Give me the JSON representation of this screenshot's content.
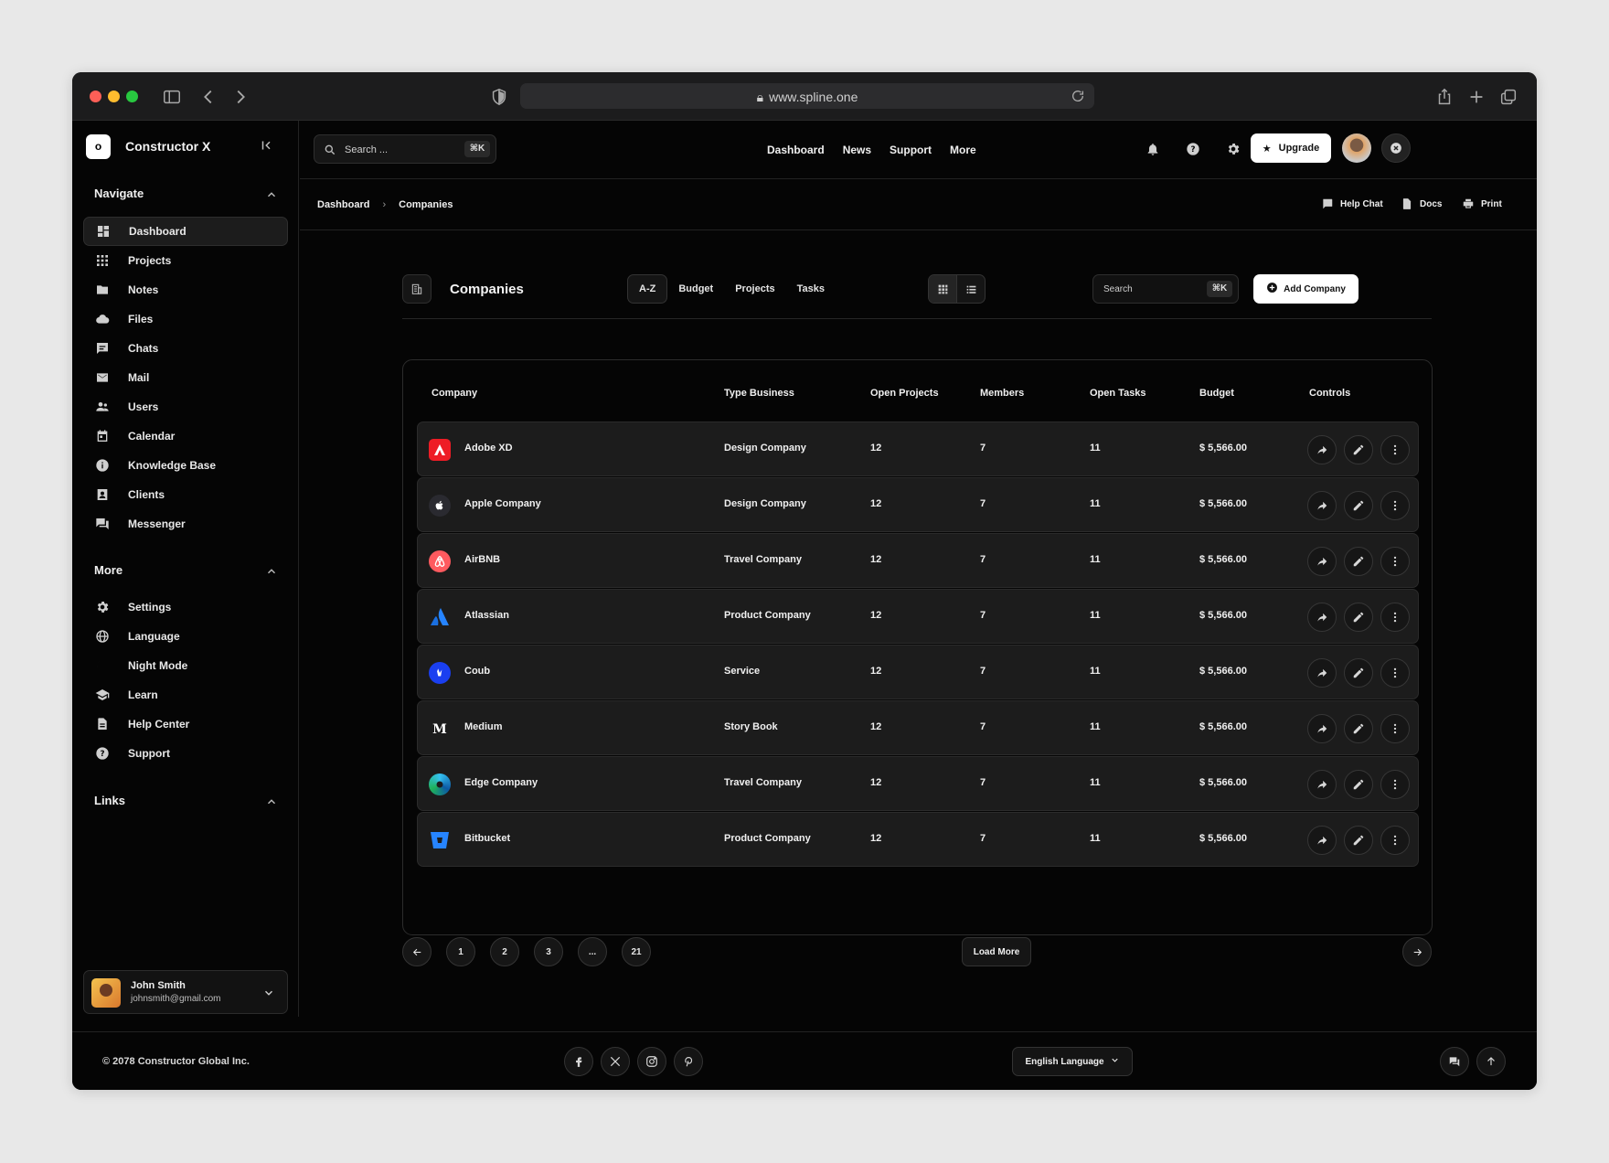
{
  "browser": {
    "url": "www.spline.one"
  },
  "sidebar": {
    "brand_logo": "o",
    "brand_name": "Constructor X",
    "navigate_title": "Navigate",
    "navigate": [
      {
        "label": "Dashboard",
        "icon": "dashboard-icon"
      },
      {
        "label": "Projects",
        "icon": "grid-icon"
      },
      {
        "label": "Notes",
        "icon": "folder-icon"
      },
      {
        "label": "Files",
        "icon": "cloud-icon"
      },
      {
        "label": "Chats",
        "icon": "chat-icon"
      },
      {
        "label": "Mail",
        "icon": "mail-icon"
      },
      {
        "label": "Users",
        "icon": "users-icon"
      },
      {
        "label": "Calendar",
        "icon": "calendar-icon"
      },
      {
        "label": "Knowledge Base",
        "icon": "info-icon"
      },
      {
        "label": "Clients",
        "icon": "contact-card-icon"
      },
      {
        "label": "Messenger",
        "icon": "forum-icon"
      }
    ],
    "more_title": "More",
    "more": [
      {
        "label": "Settings",
        "icon": "gear-icon"
      },
      {
        "label": "Language",
        "icon": "globe-icon"
      },
      {
        "label": "Night Mode",
        "icon": "moon-icon"
      },
      {
        "label": "Learn",
        "icon": "graduation-cap-icon"
      },
      {
        "label": "Help Center",
        "icon": "document-icon"
      },
      {
        "label": "Support",
        "icon": "help-circle-icon"
      }
    ],
    "links_title": "Links",
    "user": {
      "name": "John Smith",
      "email": "johnsmith@gmail.com"
    }
  },
  "topbar": {
    "search_placeholder": "Search ...",
    "search_shortcut": "⌘K",
    "nav": [
      "Dashboard",
      "News",
      "Support",
      "More"
    ],
    "upgrade_label": "Upgrade"
  },
  "breadcrumb": {
    "items": [
      "Dashboard",
      "Companies"
    ],
    "actions": [
      "Help Chat",
      "Docs",
      "Print"
    ]
  },
  "page": {
    "title": "Companies",
    "tabs": [
      "A-Z",
      "Budget",
      "Projects",
      "Tasks"
    ],
    "active_tab": "A-Z",
    "search_placeholder": "Search",
    "search_shortcut": "⌘K",
    "add_label": "Add Company"
  },
  "table": {
    "columns": [
      "Company",
      "Type Business",
      "Open Projects",
      "Members",
      "Open Tasks",
      "Budget",
      "Controls"
    ],
    "rows": [
      {
        "company": "Adobe XD",
        "type": "Design Company",
        "projects": "12",
        "members": "7",
        "tasks": "11",
        "budget": "$ 5,566.00"
      },
      {
        "company": "Apple Company",
        "type": "Design Company",
        "projects": "12",
        "members": "7",
        "tasks": "11",
        "budget": "$ 5,566.00"
      },
      {
        "company": "AirBNB",
        "type": "Travel Company",
        "projects": "12",
        "members": "7",
        "tasks": "11",
        "budget": "$ 5,566.00"
      },
      {
        "company": "Atlassian",
        "type": "Product Company",
        "projects": "12",
        "members": "7",
        "tasks": "11",
        "budget": "$ 5,566.00"
      },
      {
        "company": "Coub",
        "type": "Service",
        "projects": "12",
        "members": "7",
        "tasks": "11",
        "budget": "$ 5,566.00"
      },
      {
        "company": "Medium",
        "type": "Story Book",
        "projects": "12",
        "members": "7",
        "tasks": "11",
        "budget": "$ 5,566.00"
      },
      {
        "company": "Edge Company",
        "type": "Travel Company",
        "projects": "12",
        "members": "7",
        "tasks": "11",
        "budget": "$ 5,566.00"
      },
      {
        "company": "Bitbucket",
        "type": "Product Company",
        "projects": "12",
        "members": "7",
        "tasks": "11",
        "budget": "$ 5,566.00"
      }
    ]
  },
  "pagination": {
    "pages": [
      "1",
      "2",
      "3",
      "...",
      "21"
    ],
    "load_more": "Load More"
  },
  "footer": {
    "copyright": "© 2078 Constructor Global Inc.",
    "language": "English Language"
  },
  "colors": {
    "background": "#050505",
    "surface": "#1c1c1c",
    "accent": "#ffffff"
  }
}
